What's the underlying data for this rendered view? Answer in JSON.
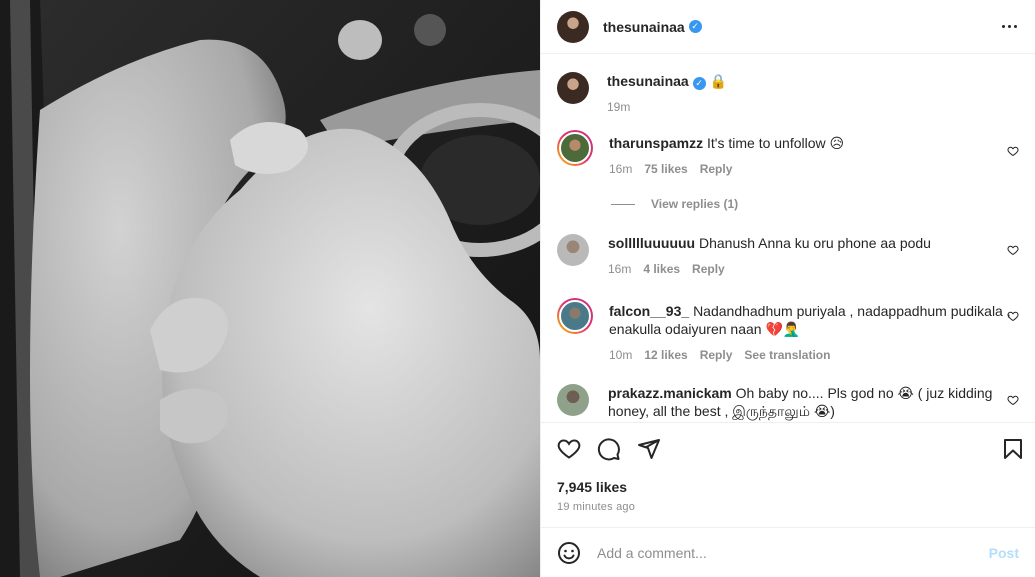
{
  "post": {
    "username": "thesunainaa",
    "caption_emoji": "🔒",
    "caption_time": "19m",
    "likes": "7,945 likes",
    "time_ago": "19 minutes ago"
  },
  "comments": [
    {
      "username": "tharunspamzz",
      "text": "It's time to unfollow 😥",
      "time": "16m",
      "likes": "75 likes",
      "reply": "Reply",
      "view_replies": "View replies (1)"
    },
    {
      "username": "sollllluuuuuu",
      "text": "Dhanush Anna ku oru phone aa podu",
      "time": "16m",
      "likes": "4 likes",
      "reply": "Reply"
    },
    {
      "username": "falcon__93_",
      "text": "Nadandhadhum puriyala , nadappadhum pudikala , enakulla odaiyuren naan 💔🤦‍♂️",
      "time": "10m",
      "likes": "12 likes",
      "reply": "Reply",
      "translate": "See translation"
    },
    {
      "username": "prakazz.manickam",
      "text": "Oh baby no.... Pls god no 😭 ( juz kidding honey, all the best , இருந்தாலும் 😭)"
    }
  ],
  "composer": {
    "placeholder": "Add a comment...",
    "post_label": "Post"
  },
  "colors": {
    "link": "#3897f0",
    "muted": "#8e8e8e",
    "post_disabled": "#b2dffc"
  }
}
